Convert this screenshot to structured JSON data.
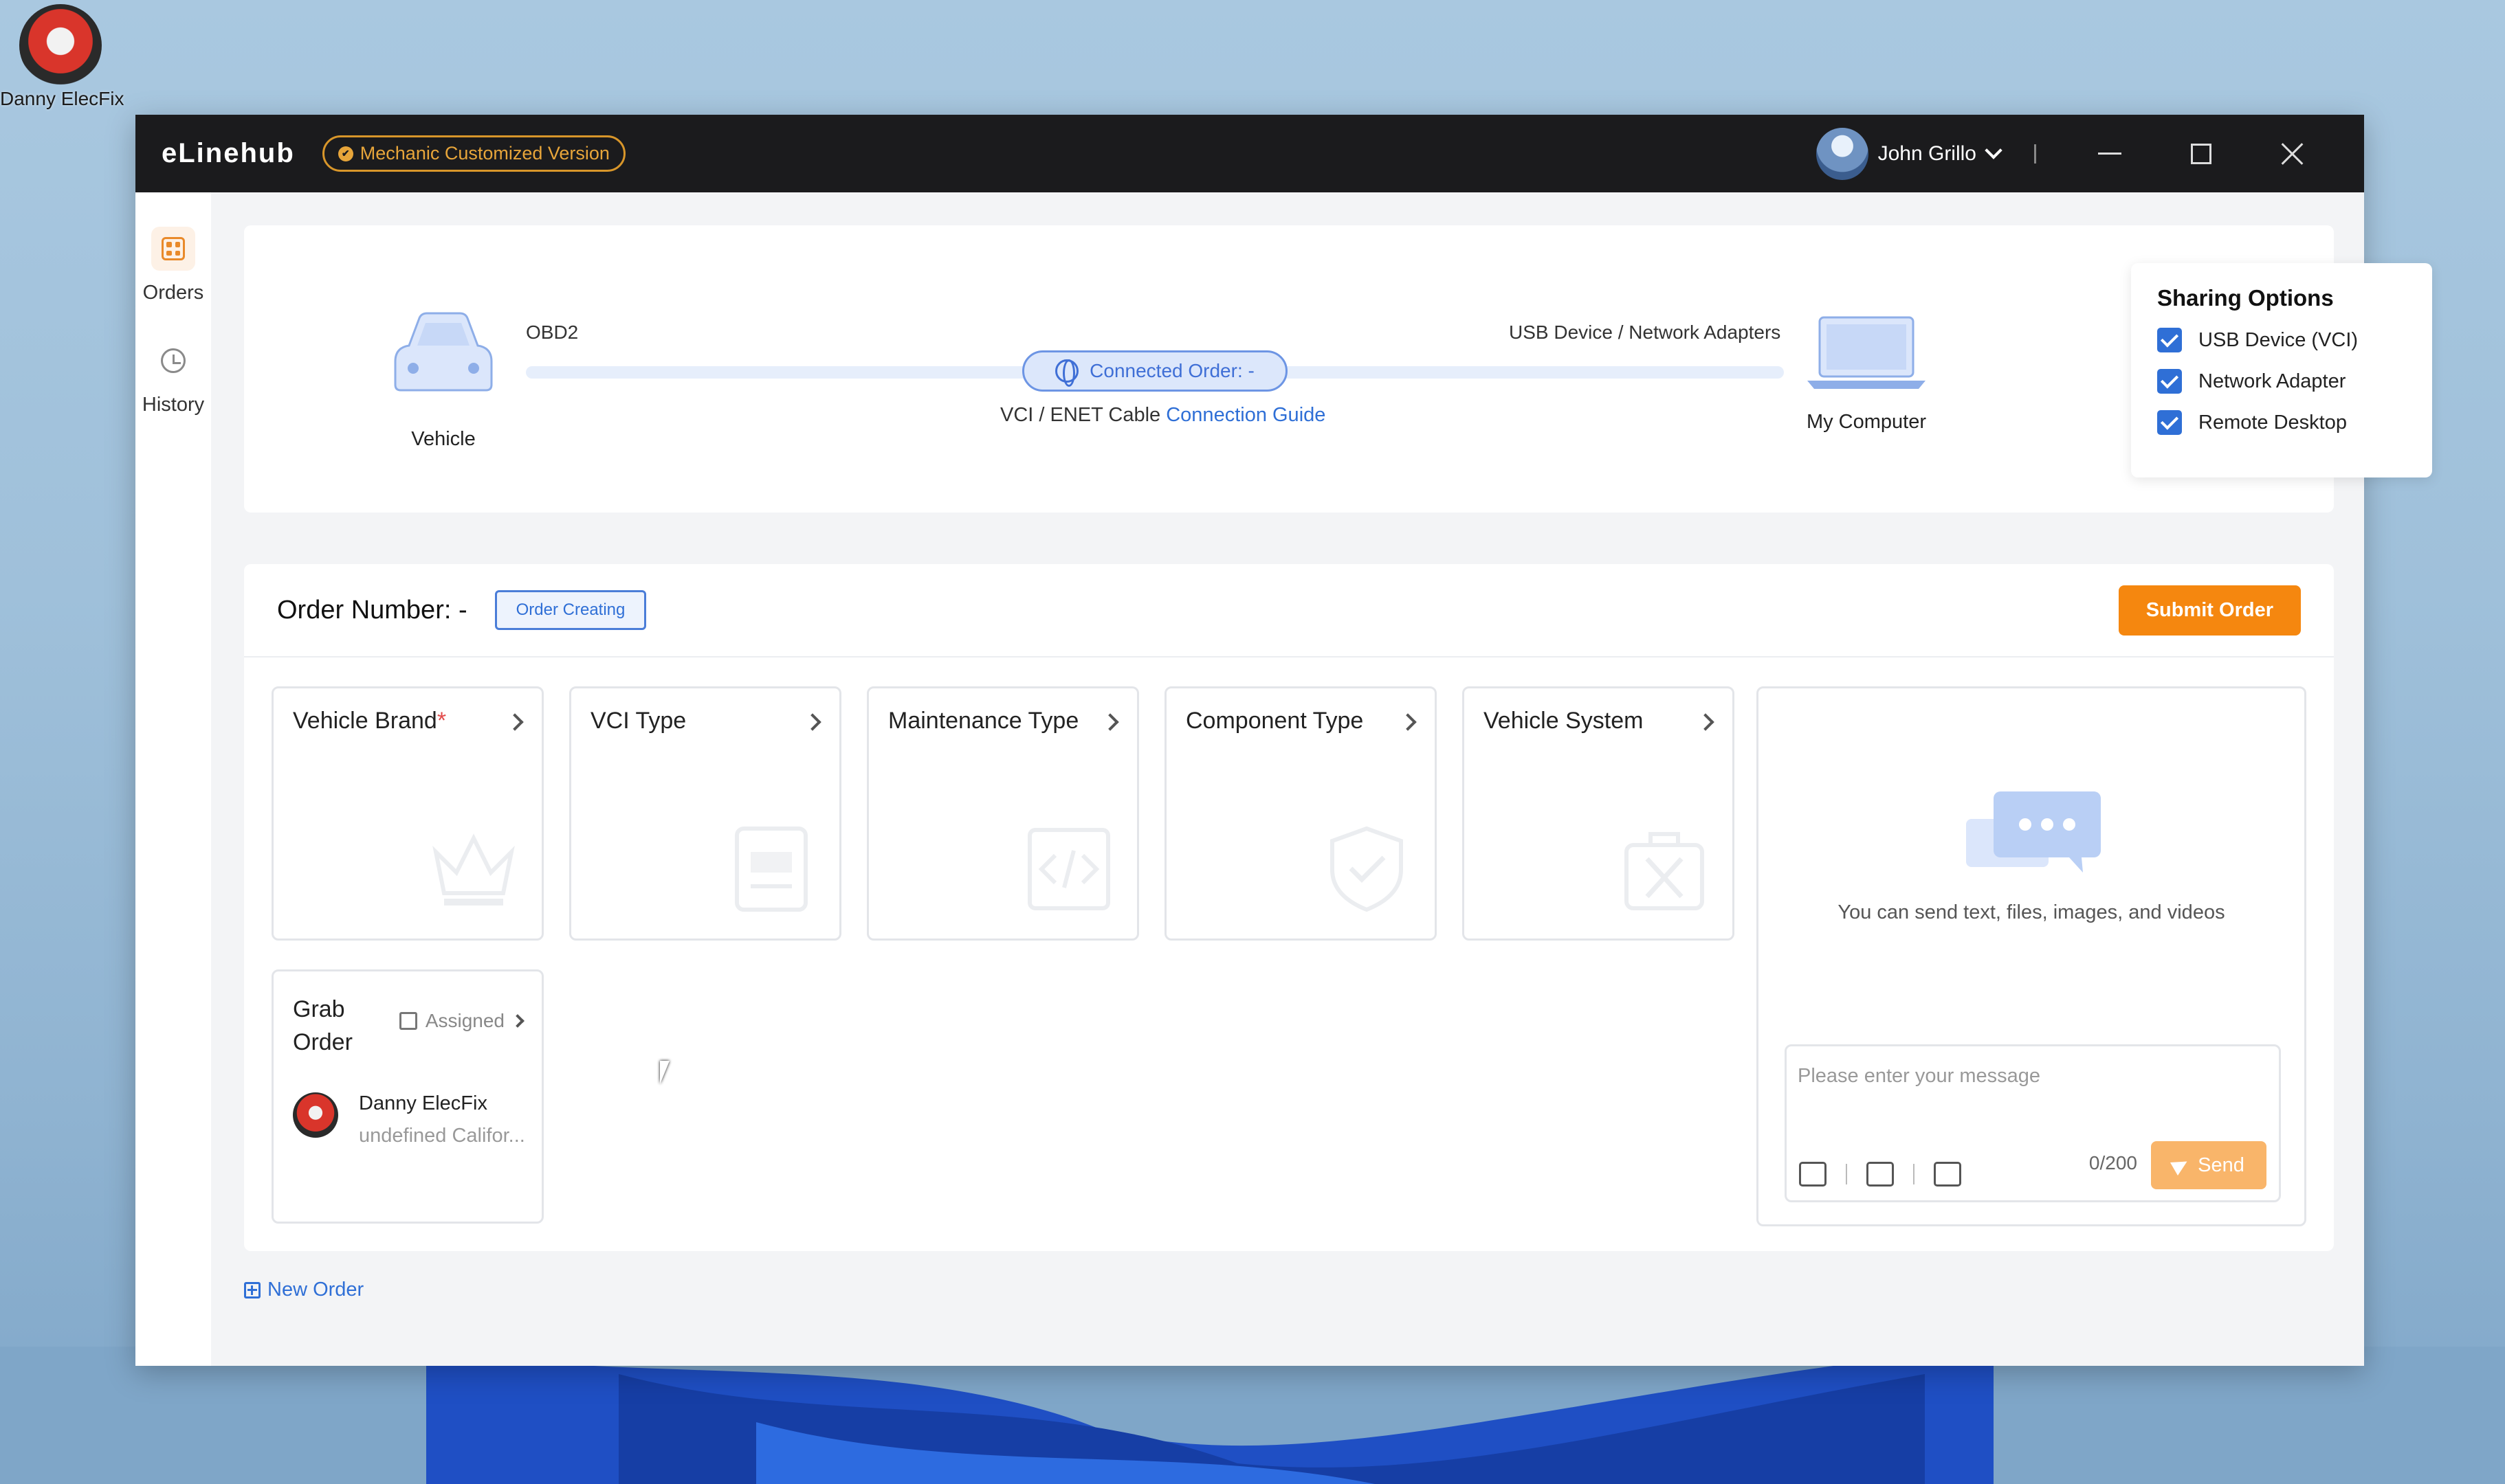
{
  "desktop": {
    "icon_label": "Danny ElecFix"
  },
  "titlebar": {
    "app_name": "eLinehub",
    "version_badge": "Mechanic Customized Version",
    "username": "John Grillo"
  },
  "sidebar": {
    "items": [
      {
        "label": "Orders",
        "icon": "grid-icon",
        "active": true
      },
      {
        "label": "History",
        "icon": "clock-icon",
        "active": false
      }
    ]
  },
  "connection": {
    "vehicle_label": "Vehicle",
    "obd2_label": "OBD2",
    "adapters_label": "USB Device / Network Adapters",
    "connected_order": "Connected Order: -",
    "cable_label": "VCI / ENET Cable",
    "guide_link": "Connection Guide",
    "computer_label": "My Computer"
  },
  "sharing": {
    "title": "Sharing Options",
    "options": [
      {
        "label": "USB Device (VCI)",
        "checked": true
      },
      {
        "label": "Network Adapter",
        "checked": true
      },
      {
        "label": "Remote Desktop",
        "checked": true
      }
    ]
  },
  "order": {
    "number_label": "Order Number: -",
    "status": "Order Creating",
    "submit_label": "Submit Order",
    "cards": [
      {
        "title": "Vehicle Brand",
        "required": "*",
        "watermark": "crown-icon"
      },
      {
        "title": "VCI Type",
        "required": "",
        "watermark": "document-icon"
      },
      {
        "title": "Maintenance Type",
        "required": "",
        "watermark": "code-icon"
      },
      {
        "title": "Component Type",
        "required": "",
        "watermark": "shield-check-icon"
      },
      {
        "title": "Vehicle System",
        "required": "",
        "watermark": "toolbox-icon"
      }
    ],
    "grab": {
      "title": "Grab Order",
      "assigned": "Assigned",
      "user_name": "Danny ElecFix",
      "user_location": "undefined Califor..."
    }
  },
  "chat": {
    "hint": "You can send text, files, images, and videos",
    "placeholder": "Please enter your message",
    "counter": "0/200",
    "send_label": "Send"
  },
  "footer": {
    "new_order": "New Order"
  },
  "colors": {
    "accent": "#f5870f",
    "link": "#2f6fd6",
    "titlebar": "#1b1b1d"
  }
}
